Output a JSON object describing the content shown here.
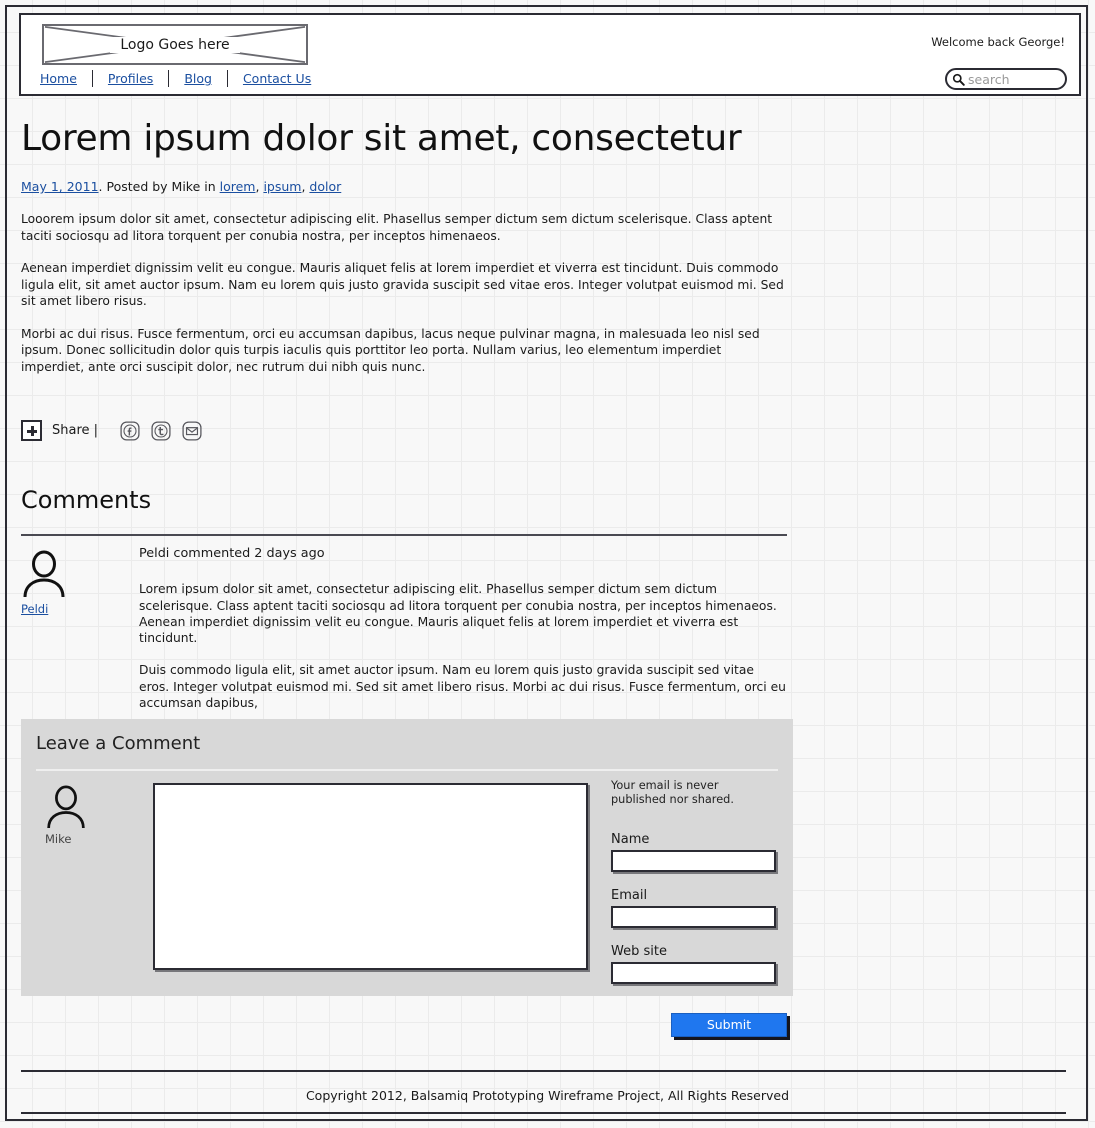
{
  "header": {
    "logo_text": "Logo Goes here",
    "welcome_text": "Welcome back George!",
    "nav": [
      {
        "label": "Home"
      },
      {
        "label": "Profiles"
      },
      {
        "label": "Blog"
      },
      {
        "label": "Contact Us"
      }
    ],
    "search": {
      "placeholder": "search",
      "value": ""
    }
  },
  "post": {
    "title": "Lorem ipsum dolor sit amet, consectetur",
    "byline": {
      "date": "May 1, 2011",
      "middle": ". Posted by Mike in ",
      "tags": [
        "lorem",
        "ipsum",
        "dolor"
      ]
    },
    "paragraphs": [
      "Looorem ipsum dolor sit amet, consectetur adipiscing elit. Phasellus semper dictum sem dictum scelerisque. Class aptent taciti sociosqu ad litora torquent per conubia nostra, per inceptos himenaeos.",
      "Aenean imperdiet dignissim velit eu congue. Mauris aliquet felis at lorem imperdiet et viverra est tincidunt. Duis commodo ligula elit, sit amet auctor ipsum. Nam eu lorem quis justo gravida suscipit sed vitae eros. Integer volutpat euismod mi. Sed sit amet libero risus.",
      "Morbi ac dui risus. Fusce fermentum, orci eu accumsan dapibus, lacus neque pulvinar magna, in malesuada leo nisl sed ipsum. Donec sollicitudin dolor quis turpis iaculis quis porttitor leo porta. Nullam varius, leo elementum imperdiet imperdiet, ante orci suscipit dolor, nec rutrum dui nibh quis nunc."
    ]
  },
  "share": {
    "label": "Share |",
    "icons": [
      "facebook-icon",
      "twitter-icon",
      "email-icon"
    ]
  },
  "comments": {
    "heading": "Comments",
    "items": [
      {
        "author": "Peldi",
        "meta": "Peldi commented 2 days ago",
        "paragraphs": [
          "Lorem ipsum dolor sit amet, consectetur adipiscing elit. Phasellus semper dictum sem dictum scelerisque. Class aptent taciti sociosqu ad litora torquent per conubia nostra, per inceptos himenaeos. Aenean imperdiet dignissim velit eu congue. Mauris aliquet felis at lorem imperdiet et viverra est tincidunt.",
          "Duis commodo ligula elit, sit amet auctor ipsum. Nam eu lorem quis justo gravida suscipit sed vitae eros. Integer volutpat euismod mi. Sed sit amet libero risus. Morbi ac dui risus. Fusce fermentum, orci eu accumsan dapibus,"
        ]
      }
    ]
  },
  "leave_comment": {
    "heading": "Leave a Comment",
    "avatar_name": "Mike",
    "textarea_value": "",
    "privacy_note": "Your email is never published nor shared.",
    "fields": [
      {
        "label": "Name",
        "value": ""
      },
      {
        "label": "Email",
        "value": ""
      },
      {
        "label": "Web site",
        "value": ""
      }
    ],
    "submit_label": "Submit"
  },
  "footer": {
    "copyright": "Copyright 2012, Balsamiq Prototyping Wireframe Project, All Rights Reserved"
  },
  "colors": {
    "link": "#1b4fa0",
    "submit_blue": "#1f77ef",
    "panel_gray": "#d8d8d8",
    "ink": "#2b2b33"
  }
}
